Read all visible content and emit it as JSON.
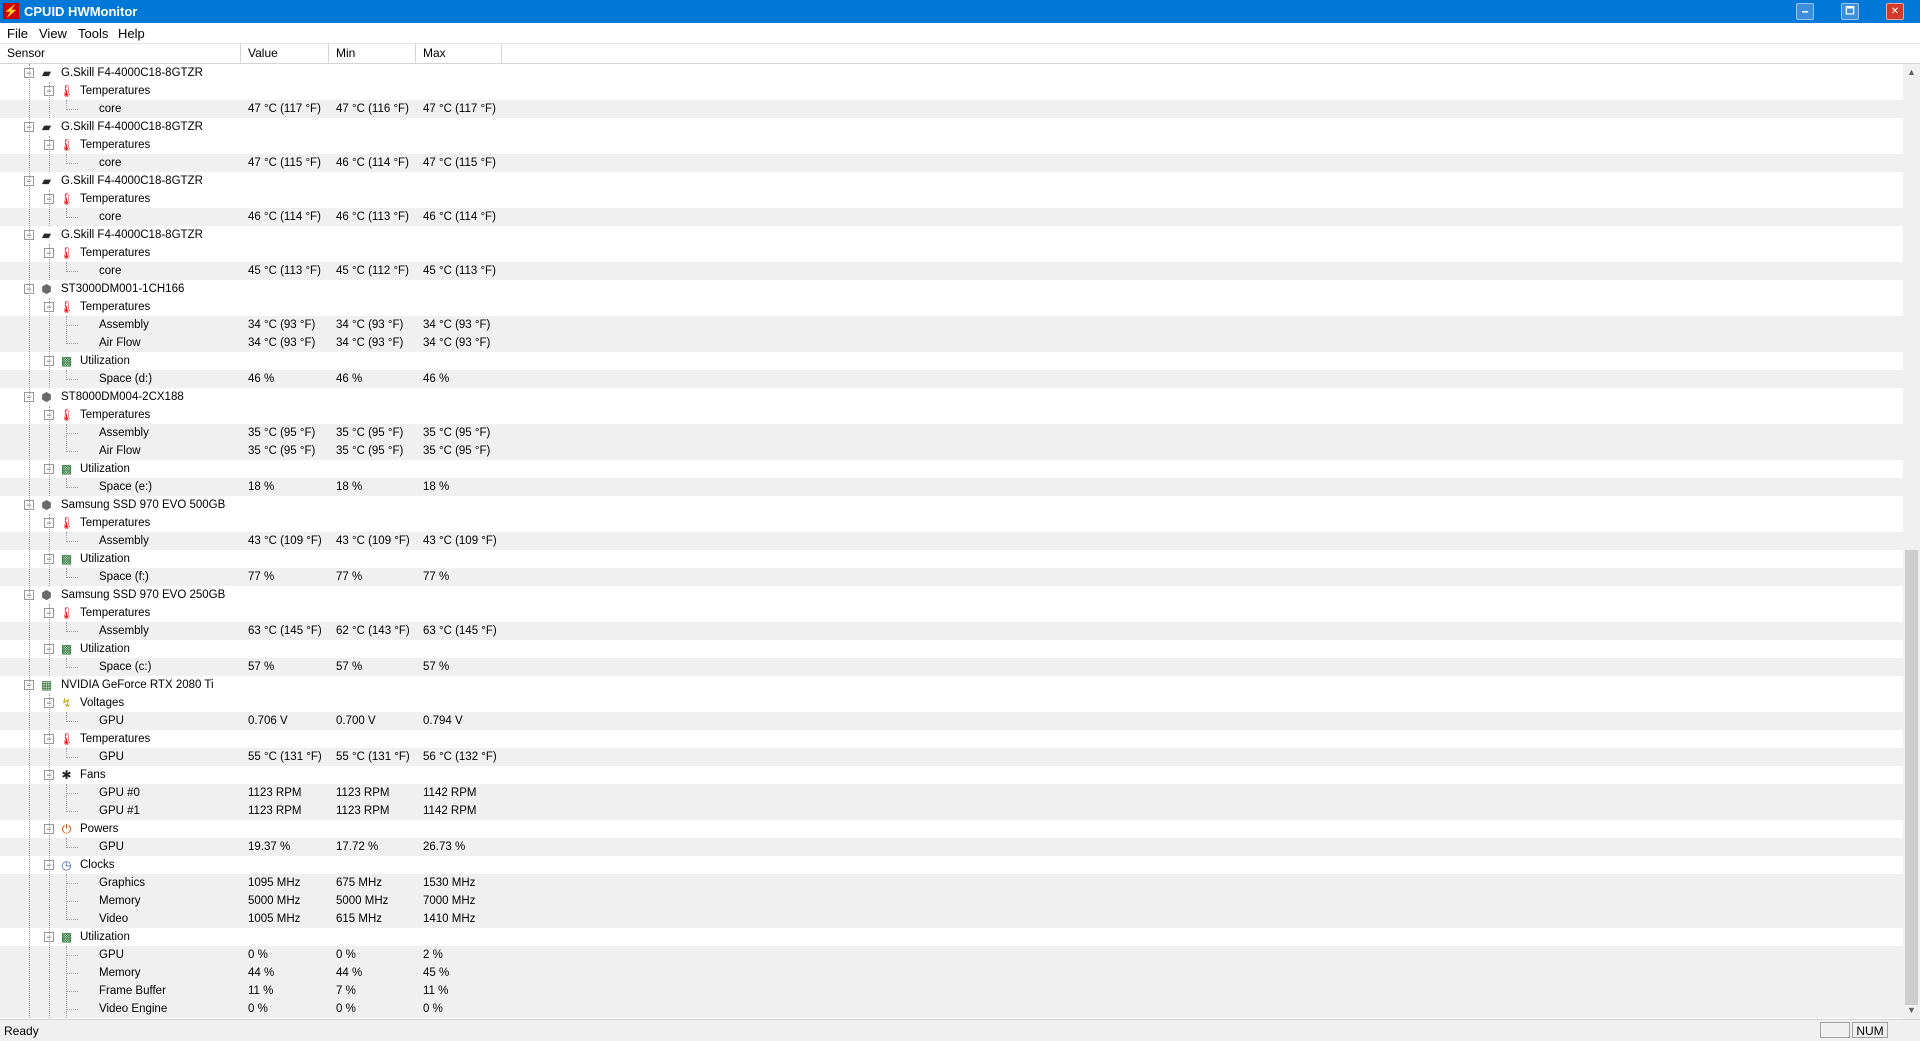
{
  "window": {
    "title": "CPUID HWMonitor",
    "controls": {
      "minimize": "🗕",
      "maximize": "🗖",
      "close": "✕"
    }
  },
  "menu": [
    "File",
    "View",
    "Tools",
    "Help"
  ],
  "columns": [
    "Sensor",
    "Value",
    "Min",
    "Max"
  ],
  "rows": [
    {
      "level": 1,
      "type": "device",
      "icon": "ram-icon",
      "label": "G.Skill F4-4000C18-8GTZR"
    },
    {
      "level": 2,
      "type": "group",
      "icon": "thermometer-icon",
      "label": "Temperatures"
    },
    {
      "level": 3,
      "type": "sensor",
      "label": "core",
      "value": "47 °C  (117 °F)",
      "min": "47 °C  (116 °F)",
      "max": "47 °C  (117 °F)"
    },
    {
      "level": 1,
      "type": "device",
      "icon": "ram-icon",
      "label": "G.Skill F4-4000C18-8GTZR"
    },
    {
      "level": 2,
      "type": "group",
      "icon": "thermometer-icon",
      "label": "Temperatures"
    },
    {
      "level": 3,
      "type": "sensor",
      "label": "core",
      "value": "47 °C  (115 °F)",
      "min": "46 °C  (114 °F)",
      "max": "47 °C  (115 °F)"
    },
    {
      "level": 1,
      "type": "device",
      "icon": "ram-icon",
      "label": "G.Skill F4-4000C18-8GTZR"
    },
    {
      "level": 2,
      "type": "group",
      "icon": "thermometer-icon",
      "label": "Temperatures"
    },
    {
      "level": 3,
      "type": "sensor",
      "label": "core",
      "value": "46 °C  (114 °F)",
      "min": "46 °C  (113 °F)",
      "max": "46 °C  (114 °F)"
    },
    {
      "level": 1,
      "type": "device",
      "icon": "ram-icon",
      "label": "G.Skill F4-4000C18-8GTZR"
    },
    {
      "level": 2,
      "type": "group",
      "icon": "thermometer-icon",
      "label": "Temperatures"
    },
    {
      "level": 3,
      "type": "sensor",
      "label": "core",
      "value": "45 °C  (113 °F)",
      "min": "45 °C  (112 °F)",
      "max": "45 °C  (113 °F)"
    },
    {
      "level": 1,
      "type": "device",
      "icon": "hdd-icon",
      "label": "ST3000DM001-1CH166"
    },
    {
      "level": 2,
      "type": "group",
      "icon": "thermometer-icon",
      "label": "Temperatures"
    },
    {
      "level": 3,
      "type": "sensor",
      "label": "Assembly",
      "value": "34 °C  (93 °F)",
      "min": "34 °C  (93 °F)",
      "max": "34 °C  (93 °F)"
    },
    {
      "level": 3,
      "type": "sensor",
      "label": "Air Flow",
      "value": "34 °C  (93 °F)",
      "min": "34 °C  (93 °F)",
      "max": "34 °C  (93 °F)"
    },
    {
      "level": 2,
      "type": "group",
      "icon": "utilization-icon",
      "label": "Utilization"
    },
    {
      "level": 3,
      "type": "sensor",
      "label": "Space (d:)",
      "value": "46 %",
      "min": "46 %",
      "max": "46 %"
    },
    {
      "level": 1,
      "type": "device",
      "icon": "hdd-icon",
      "label": "ST8000DM004-2CX188"
    },
    {
      "level": 2,
      "type": "group",
      "icon": "thermometer-icon",
      "label": "Temperatures"
    },
    {
      "level": 3,
      "type": "sensor",
      "label": "Assembly",
      "value": "35 °C  (95 °F)",
      "min": "35 °C  (95 °F)",
      "max": "35 °C  (95 °F)"
    },
    {
      "level": 3,
      "type": "sensor",
      "label": "Air Flow",
      "value": "35 °C  (95 °F)",
      "min": "35 °C  (95 °F)",
      "max": "35 °C  (95 °F)"
    },
    {
      "level": 2,
      "type": "group",
      "icon": "utilization-icon",
      "label": "Utilization"
    },
    {
      "level": 3,
      "type": "sensor",
      "label": "Space (e:)",
      "value": "18 %",
      "min": "18 %",
      "max": "18 %"
    },
    {
      "level": 1,
      "type": "device",
      "icon": "hdd-icon",
      "label": "Samsung SSD 970 EVO 500GB"
    },
    {
      "level": 2,
      "type": "group",
      "icon": "thermometer-icon",
      "label": "Temperatures"
    },
    {
      "level": 3,
      "type": "sensor",
      "label": "Assembly",
      "value": "43 °C  (109 °F)",
      "min": "43 °C  (109 °F)",
      "max": "43 °C  (109 °F)"
    },
    {
      "level": 2,
      "type": "group",
      "icon": "utilization-icon",
      "label": "Utilization"
    },
    {
      "level": 3,
      "type": "sensor",
      "label": "Space (f:)",
      "value": "77 %",
      "min": "77 %",
      "max": "77 %"
    },
    {
      "level": 1,
      "type": "device",
      "icon": "hdd-icon",
      "label": "Samsung SSD 970 EVO 250GB"
    },
    {
      "level": 2,
      "type": "group",
      "icon": "thermometer-icon",
      "label": "Temperatures"
    },
    {
      "level": 3,
      "type": "sensor",
      "label": "Assembly",
      "value": "63 °C  (145 °F)",
      "min": "62 °C  (143 °F)",
      "max": "63 °C  (145 °F)"
    },
    {
      "level": 2,
      "type": "group",
      "icon": "utilization-icon",
      "label": "Utilization"
    },
    {
      "level": 3,
      "type": "sensor",
      "label": "Space (c:)",
      "value": "57 %",
      "min": "57 %",
      "max": "57 %"
    },
    {
      "level": 1,
      "type": "device",
      "icon": "gpu-icon",
      "label": "NVIDIA GeForce RTX 2080 Ti"
    },
    {
      "level": 2,
      "type": "group",
      "icon": "voltage-icon",
      "label": "Voltages"
    },
    {
      "level": 3,
      "type": "sensor",
      "label": "GPU",
      "value": "0.706 V",
      "min": "0.700 V",
      "max": "0.794 V"
    },
    {
      "level": 2,
      "type": "group",
      "icon": "thermometer-icon",
      "label": "Temperatures"
    },
    {
      "level": 3,
      "type": "sensor",
      "label": "GPU",
      "value": "55 °C  (131 °F)",
      "min": "55 °C  (131 °F)",
      "max": "56 °C  (132 °F)"
    },
    {
      "level": 2,
      "type": "group",
      "icon": "fan-icon",
      "label": "Fans"
    },
    {
      "level": 3,
      "type": "sensor",
      "label": "GPU #0",
      "value": "1123 RPM",
      "min": "1123 RPM",
      "max": "1142 RPM"
    },
    {
      "level": 3,
      "type": "sensor",
      "label": "GPU #1",
      "value": "1123 RPM",
      "min": "1123 RPM",
      "max": "1142 RPM"
    },
    {
      "level": 2,
      "type": "group",
      "icon": "power-icon",
      "label": "Powers"
    },
    {
      "level": 3,
      "type": "sensor",
      "label": "GPU",
      "value": "19.37 %",
      "min": "17.72 %",
      "max": "26.73 %"
    },
    {
      "level": 2,
      "type": "group",
      "icon": "clock-icon",
      "label": "Clocks"
    },
    {
      "level": 3,
      "type": "sensor",
      "label": "Graphics",
      "value": "1095 MHz",
      "min": "675 MHz",
      "max": "1530 MHz"
    },
    {
      "level": 3,
      "type": "sensor",
      "label": "Memory",
      "value": "5000 MHz",
      "min": "5000 MHz",
      "max": "7000 MHz"
    },
    {
      "level": 3,
      "type": "sensor",
      "label": "Video",
      "value": "1005 MHz",
      "min": "615 MHz",
      "max": "1410 MHz"
    },
    {
      "level": 2,
      "type": "group",
      "icon": "utilization-icon",
      "label": "Utilization"
    },
    {
      "level": 3,
      "type": "sensor",
      "label": "GPU",
      "value": "0 %",
      "min": "0 %",
      "max": "2 %"
    },
    {
      "level": 3,
      "type": "sensor",
      "label": "Memory",
      "value": "44 %",
      "min": "44 %",
      "max": "45 %"
    },
    {
      "level": 3,
      "type": "sensor",
      "label": "Frame Buffer",
      "value": "11 %",
      "min": "7 %",
      "max": "11 %"
    },
    {
      "level": 3,
      "type": "sensor",
      "label": "Video Engine",
      "value": "0 %",
      "min": "0 %",
      "max": "0 %"
    }
  ],
  "status": {
    "text": "Ready",
    "num": "NUM"
  },
  "colors": {
    "accent": "#0078d7",
    "row_alt": "#f0f0f0"
  }
}
